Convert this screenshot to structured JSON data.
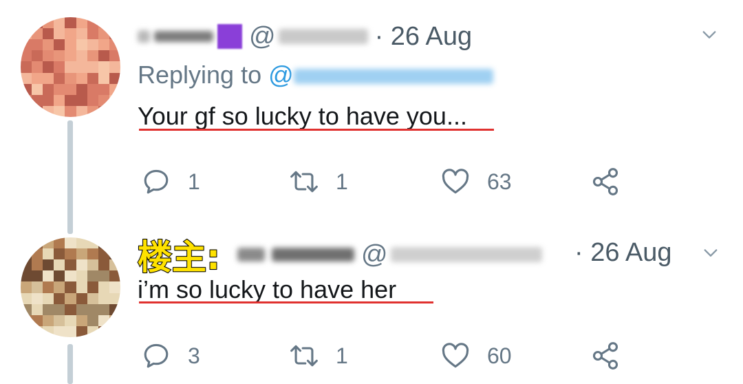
{
  "tweet1": {
    "handle_prefix": "@",
    "date": "· 26 Aug",
    "replying_to_label": "Replying to",
    "mention_prefix": "@",
    "text": "Your gf so lucky to have you...",
    "replies": "1",
    "retweets": "1",
    "likes": "63"
  },
  "tweet2": {
    "op_label": "楼主:",
    "handle_prefix": "@",
    "date": "· 26 Aug",
    "text": "i’m so lucky to have her",
    "replies": "3",
    "retweets": "1",
    "likes": "60"
  },
  "icons": [
    "reply-icon",
    "retweet-icon",
    "like-icon",
    "share-icon",
    "chevron-down-icon"
  ],
  "colors": {
    "mention": "#2f9be0",
    "muted": "#657786",
    "underline": "#e0312f",
    "op_label": "#ffe200",
    "thread_line": "#c4cfd6"
  }
}
